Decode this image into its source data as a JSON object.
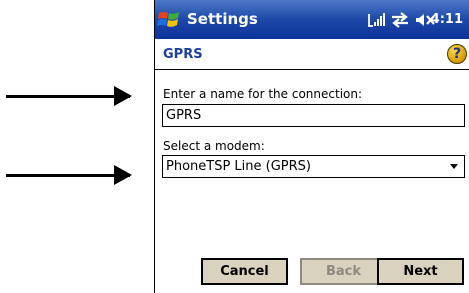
{
  "window": {
    "title": "Settings",
    "time": "4:11"
  },
  "header": {
    "title": "GPRS",
    "help_glyph": "?"
  },
  "form": {
    "name_label": "Enter a name for the connection:",
    "name_value": "GPRS",
    "modem_label": "Select a modem:",
    "modem_value": "PhoneTSP Line (GPRS)"
  },
  "buttons": {
    "cancel": "Cancel",
    "back": "Back",
    "next": "Next"
  },
  "icons": {
    "logo": "windows-logo-icon",
    "signal": "signal-strength-icon",
    "connectivity": "connection-arrows-icon",
    "speaker": "speaker-muted-icon",
    "help": "help-icon",
    "dropdown": "chevron-down-icon"
  }
}
